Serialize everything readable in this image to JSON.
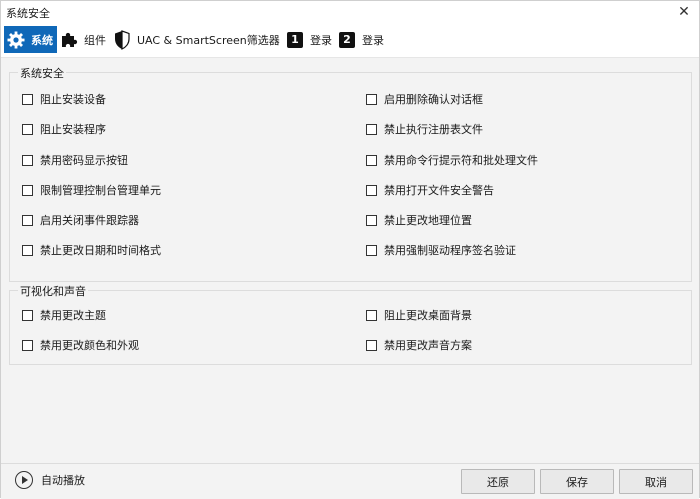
{
  "window": {
    "title": "系统安全"
  },
  "tabs": [
    {
      "label": "系统",
      "icon": "gear-icon",
      "active": true
    },
    {
      "label": "组件",
      "icon": "puzzle-icon"
    },
    {
      "label": "UAC & SmartScreen筛选器",
      "icon": "shield-icon"
    },
    {
      "label": "登录",
      "icon": "number-1-icon",
      "badge": "1"
    },
    {
      "label": "登录",
      "icon": "number-2-icon",
      "badge": "2"
    }
  ],
  "groups": {
    "system_security": {
      "title": "系统安全",
      "left": [
        "阻止安装设备",
        "阻止安装程序",
        "禁用密码显示按钮",
        "限制管理控制台管理单元",
        "启用关闭事件跟踪器",
        "禁止更改日期和时间格式"
      ],
      "right": [
        "启用删除确认对话框",
        "禁止执行注册表文件",
        "禁用命令行提示符和批处理文件",
        "禁用打开文件安全警告",
        "禁止更改地理位置",
        "禁用强制驱动程序签名验证"
      ]
    },
    "visual_sound": {
      "title": "可视化和声音",
      "left": [
        "禁用更改主题",
        "禁用更改颜色和外观"
      ],
      "right": [
        "阻止更改桌面背景",
        "禁用更改声音方案"
      ]
    }
  },
  "footer": {
    "autoplay_label": "自动播放",
    "restore_label": "还原",
    "save_label": "保存",
    "cancel_label": "取消"
  },
  "colors": {
    "accent": "#0f68b8",
    "panel": "#f3f3f3"
  }
}
